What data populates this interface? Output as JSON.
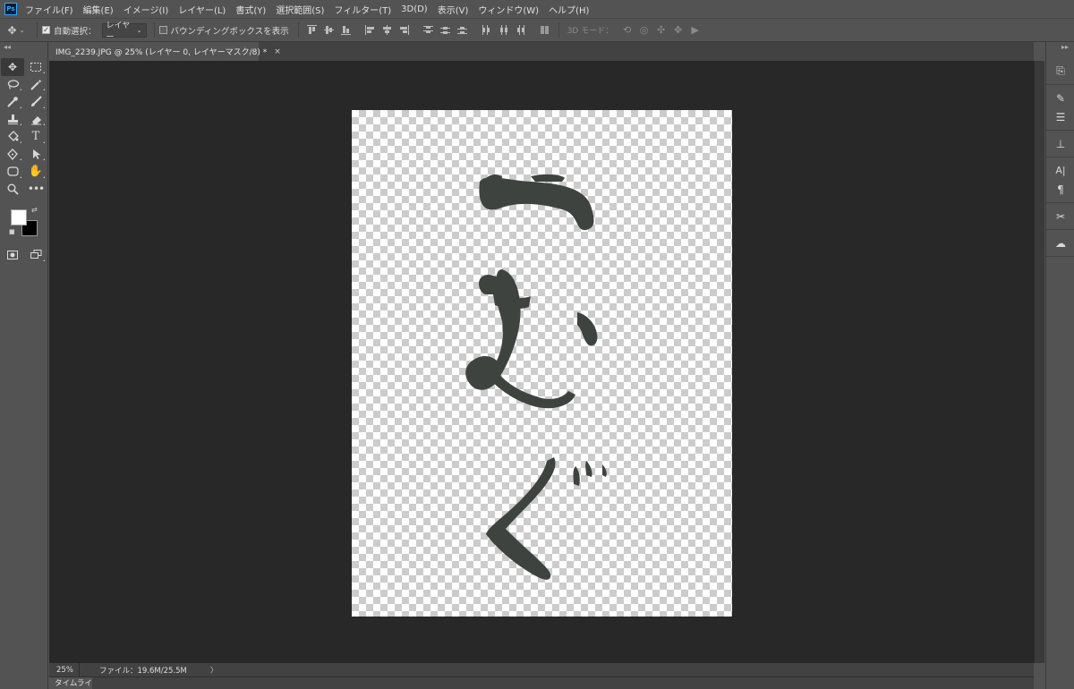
{
  "app": {
    "logo": "Ps"
  },
  "menu": [
    "ファイル(F)",
    "編集(E)",
    "イメージ(I)",
    "レイヤー(L)",
    "書式(Y)",
    "選択範囲(S)",
    "フィルター(T)",
    "3D(D)",
    "表示(V)",
    "ウィンドウ(W)",
    "ヘルプ(H)"
  ],
  "options": {
    "auto_select_label": "自動選択：",
    "auto_select_checked": true,
    "auto_select_target": "レイヤー",
    "bounding_box_label": "バウンディングボックスを表示",
    "bounding_box_checked": false,
    "mode_3d_label": "3D モード："
  },
  "document": {
    "tab_title": "IMG_2239.JPG @ 25% (レイヤー 0, レイヤーマスク/8) *",
    "close_glyph": "×",
    "artwork_icon": "brush-calligraphy-image"
  },
  "status": {
    "zoom": "25%",
    "file_info": "ファイル：19.6M/25.5M",
    "arrow": "〉"
  },
  "timeline": {
    "tab_label": "タイムライン"
  },
  "colors": {
    "foreground": "#ffffff",
    "background": "#000000",
    "workspace": "#282828",
    "panel": "#535353"
  }
}
